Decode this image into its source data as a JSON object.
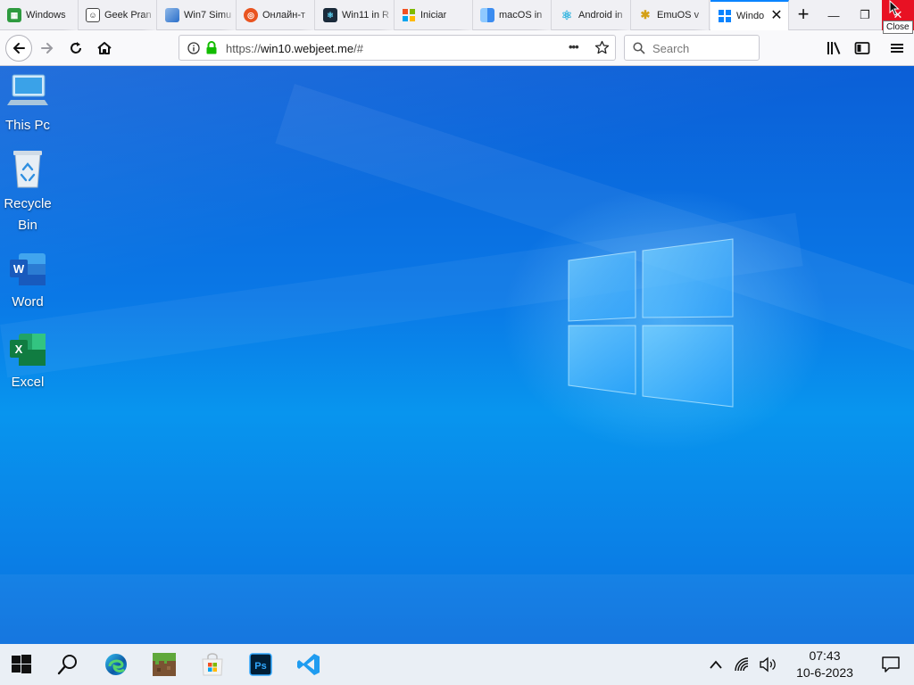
{
  "browser": {
    "tabs": [
      {
        "label": "Windows",
        "favicon": "green-spreadsheet-icon",
        "color": "#2e9a3f"
      },
      {
        "label": "Geek Pran",
        "favicon": "troll-face-icon",
        "color": "#444444"
      },
      {
        "label": "Win7 Simu",
        "favicon": "windows7-icon",
        "color": "#2a6fc9"
      },
      {
        "label": "Онлайн-т",
        "favicon": "ubuntu-icon",
        "color": "#e95420"
      },
      {
        "label": "Win11 in R",
        "favicon": "react-dark-icon",
        "color": "#1a2a3a"
      },
      {
        "label": "Iniciar",
        "favicon": "windows-logo-icon",
        "color": "#f25022"
      },
      {
        "label": "macOS in",
        "favicon": "finder-icon",
        "color": "#3b8cf0"
      },
      {
        "label": "Android in",
        "favicon": "react-icon",
        "color": "#61dafb"
      },
      {
        "label": "EmuOS v",
        "favicon": "emuos-icon",
        "color": "#d4a017"
      },
      {
        "label": "Windo",
        "favicon": "windows10-icon",
        "color": "#0a84ff",
        "active": true
      }
    ],
    "new_tab_symbol": "+",
    "minimize_symbol": "—",
    "restore_symbol": "❐",
    "close_symbol": "✕",
    "close_tooltip": "Close",
    "url_prefix": "https://",
    "url_host": "win10.webjeet.me",
    "url_suffix": "/#",
    "page_actions_symbol": "•••",
    "search_placeholder": "Search"
  },
  "desktop": {
    "icons": [
      {
        "label": "This Pc",
        "icon": "computer-icon"
      },
      {
        "label": "Recycle Bin",
        "icon": "recycle-bin-icon"
      },
      {
        "label": "Word",
        "icon": "word-icon"
      },
      {
        "label": "Excel",
        "icon": "excel-icon"
      }
    ]
  },
  "taskbar": {
    "apps": [
      "start-icon",
      "search-icon",
      "edge-icon",
      "minecraft-icon",
      "store-icon",
      "photoshop-icon",
      "vscode-icon"
    ],
    "tray": [
      "chevron-up-icon",
      "wifi-icon",
      "volume-icon"
    ],
    "time": "07:43",
    "date": "10-6-2023"
  },
  "colors": {
    "accent": "#0a84ff",
    "close_red": "#e81123",
    "secure_green": "#12bc00",
    "taskbar_bg": "#eaeff5"
  }
}
